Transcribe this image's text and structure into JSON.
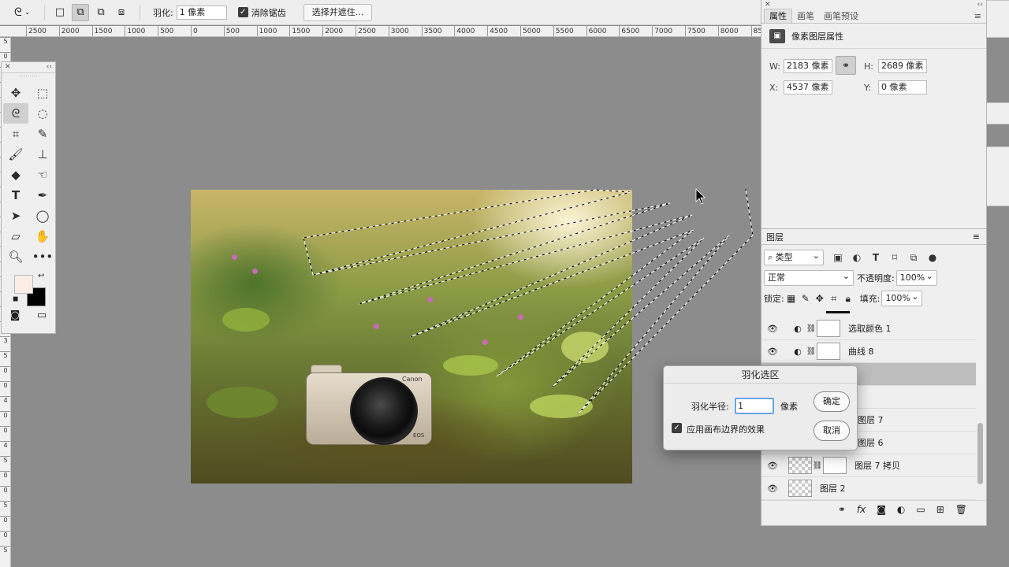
{
  "options_bar": {
    "feather_label": "羽化:",
    "feather_value": "1 像素",
    "antialias_label": "消除锯齿",
    "select_mask_button": "选择并遮住..."
  },
  "ruler_top": [
    "2500",
    "2000",
    "1500",
    "1000",
    "500",
    "0",
    "500",
    "1000",
    "1500",
    "2000",
    "2500",
    "3000",
    "3500",
    "4000",
    "4500",
    "5000",
    "5500",
    "6000",
    "6500",
    "7000",
    "7500",
    "8000",
    "85"
  ],
  "ruler_left": [
    "5",
    "0",
    "0",
    "1",
    "0",
    "0",
    "1",
    "5",
    "0",
    "0",
    "2",
    "0",
    "0",
    "2",
    "5",
    "0",
    "0",
    "3",
    "0",
    "0",
    "3",
    "5",
    "0",
    "0",
    "4",
    "0",
    "0",
    "4",
    "5",
    "0",
    "0",
    "5",
    "0",
    "0",
    "5"
  ],
  "photo": {
    "brand_text": "Canon",
    "model_text": "EOS"
  },
  "properties_panel": {
    "tabs": [
      "属性",
      "画笔",
      "画笔预设"
    ],
    "header": "像素图层属性",
    "w_label": "W:",
    "w_value": "2183 像素",
    "h_label": "H:",
    "h_value": "2689 像素",
    "x_label": "X:",
    "x_value": "4537 像素",
    "y_label": "Y:",
    "y_value": "0 像素"
  },
  "layers_panel": {
    "title": "图层",
    "filter": "类型",
    "blend_mode": "正常",
    "opacity_label": "不透明度:",
    "opacity_value": "100%",
    "lock_label": "锁定:",
    "fill_label": "填充:",
    "fill_value": "100%",
    "layers": [
      {
        "name": "选取颜色 1"
      },
      {
        "name": "曲线 8"
      },
      {
        "name": ""
      },
      {
        "name": ""
      },
      {
        "name": "图层 7"
      },
      {
        "name": "图层 6"
      },
      {
        "name": "图层 7 拷贝"
      },
      {
        "name": "图层 2"
      }
    ]
  },
  "feather_dialog": {
    "title": "羽化选区",
    "radius_label": "羽化半径:",
    "radius_value": "1",
    "unit": "像素",
    "checkbox_label": "应用画布边界的效果",
    "ok_button": "确定",
    "cancel_button": "取消"
  }
}
